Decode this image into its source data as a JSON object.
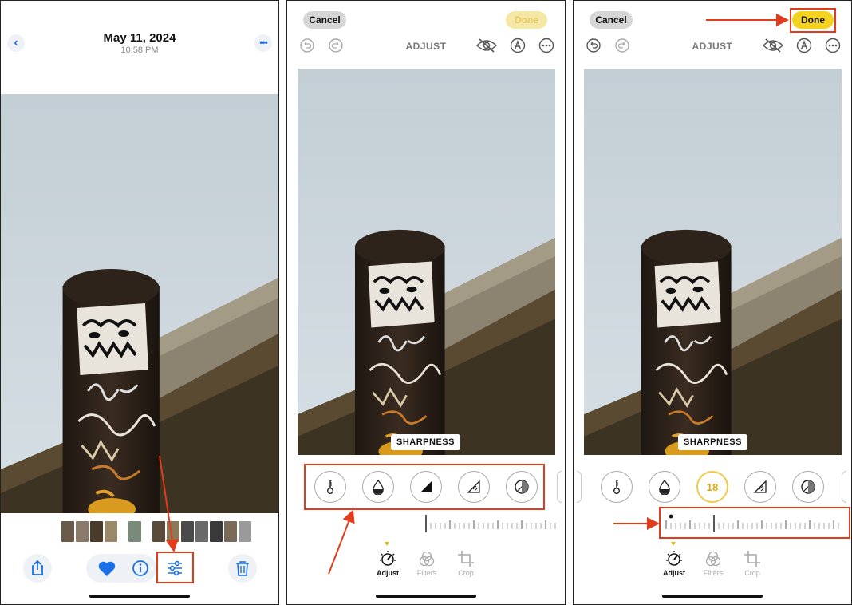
{
  "panels": {
    "photo_view": {
      "date": "May 11, 2024",
      "time": "10:58 PM",
      "icons": [
        "back-chevron-icon",
        "more-ellipsis-icon",
        "share-icon",
        "heart-icon",
        "info-icon",
        "edit-sliders-icon",
        "trash-icon"
      ]
    },
    "adjust_initial": {
      "cancel_label": "Cancel",
      "done_label": "Done",
      "title": "ADJUST",
      "tool_label": "SHARPNESS",
      "tabs": [
        {
          "label": "Adjust",
          "state": "active"
        },
        {
          "label": "Filters",
          "state": "inactive"
        },
        {
          "label": "Crop",
          "state": "inactive"
        }
      ],
      "tools": [
        "brilliance-icon",
        "highlights-icon",
        "contrast-icon",
        "vibrance-icon",
        "sharpness-icon"
      ]
    },
    "adjust_applied": {
      "cancel_label": "Cancel",
      "done_label": "Done",
      "title": "ADJUST",
      "tool_label": "SHARPNESS",
      "sharpness_value": "18",
      "tabs": [
        {
          "label": "Adjust",
          "state": "active"
        },
        {
          "label": "Filters",
          "state": "inactive"
        },
        {
          "label": "Crop",
          "state": "inactive"
        }
      ]
    }
  },
  "colors": {
    "accent_blue": "#1a6fe8",
    "done_yellow": "#f4d320",
    "annotation_red": "#e23c1c",
    "value_gold": "#d9a914"
  }
}
